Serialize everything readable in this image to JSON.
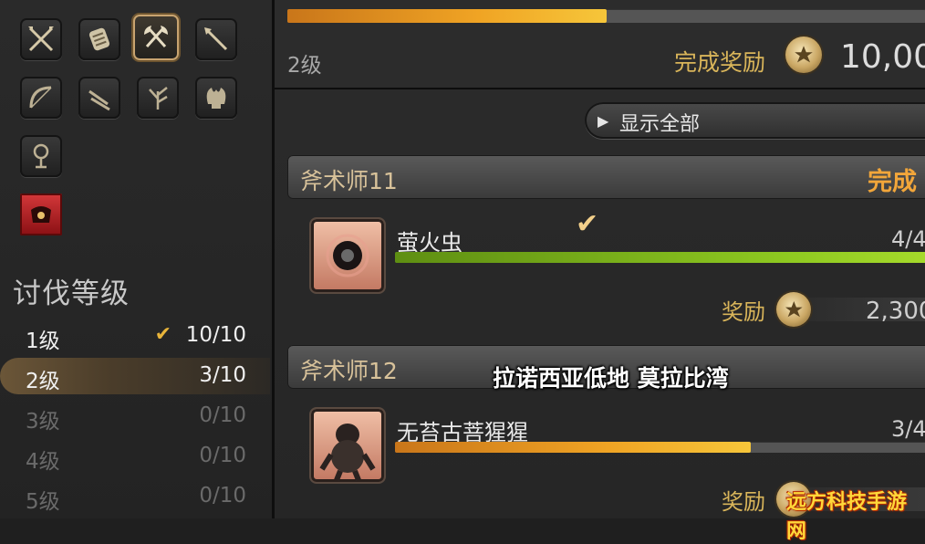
{
  "sidebar": {
    "icons": [
      {
        "name": "crossed-swords-icon"
      },
      {
        "name": "fist-icon"
      },
      {
        "name": "crossed-axes-icon",
        "selected": true
      },
      {
        "name": "lance-icon"
      },
      {
        "name": "bow-icon"
      },
      {
        "name": "twin-daggers-icon"
      },
      {
        "name": "branch-icon"
      },
      {
        "name": "flame-tree-icon"
      },
      {
        "name": "goblet-icon"
      },
      {
        "name": "red-crest-icon",
        "accent": "#c8262a"
      }
    ],
    "section_title": "讨伐等级",
    "levels": [
      {
        "label": "1级",
        "count": "10/10",
        "checked": true,
        "state": "active"
      },
      {
        "label": "2级",
        "count": "3/10",
        "state": "current"
      },
      {
        "label": "3级",
        "count": "0/10",
        "state": "dim"
      },
      {
        "label": "4级",
        "count": "0/10",
        "state": "dim"
      },
      {
        "label": "5级",
        "count": "0/10",
        "state": "dim"
      }
    ]
  },
  "summary": {
    "level": "2级",
    "progress_fraction": 0.5,
    "reward_label": "完成奖励",
    "reward_value": "10,00"
  },
  "show_all_label": "显示全部",
  "groups": [
    {
      "title": "斧术师11",
      "status": "完成",
      "target": {
        "name": "萤火虫",
        "count": "4/4",
        "progress_fraction": 1.0,
        "bar_color": "green",
        "icon": "firefly-icon",
        "completed": true,
        "reward_label": "奖励",
        "reward_value": "2,300"
      }
    },
    {
      "title": "斧术师12",
      "status": "",
      "target": {
        "name": "无苔古菩猩猩",
        "count": "3/4",
        "progress_fraction": 0.65,
        "bar_color": "orange",
        "icon": "ape-icon",
        "completed": false,
        "reward_label": "奖励"
      }
    }
  ],
  "location_subtitle": "拉诺西亚低地 莫拉比湾",
  "watermark": "远方科技手游网",
  "colors": {
    "accent_gold": "#d9b55a",
    "complete_orange": "#f2a63a",
    "progress_orange": "#f0a424",
    "progress_green": "#8dc820"
  }
}
